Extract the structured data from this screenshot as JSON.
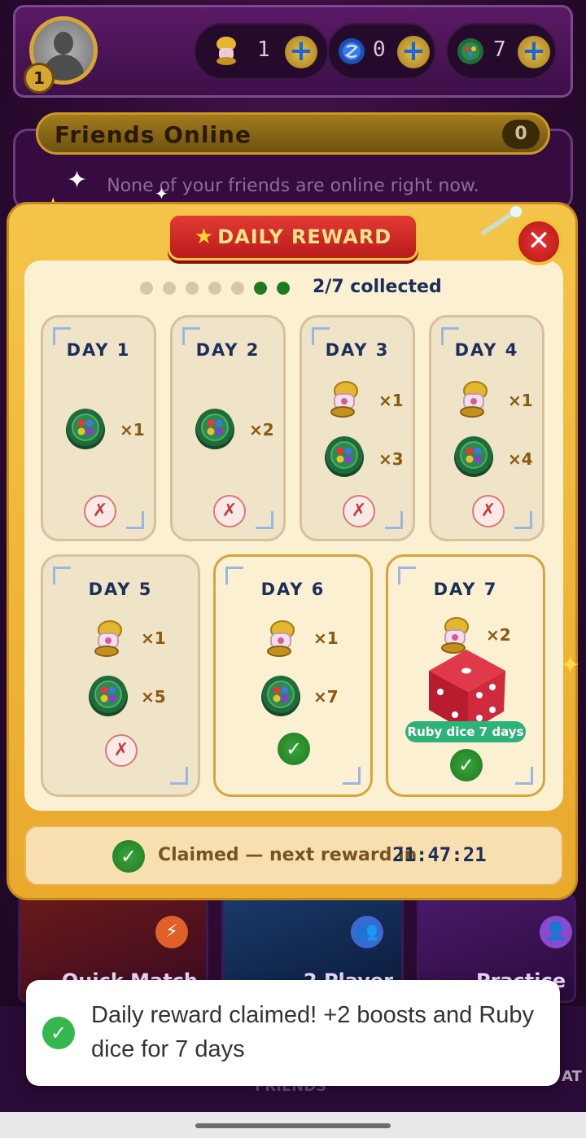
{
  "topbar": {
    "level": "1",
    "currencies": [
      {
        "icon": "boost-icon",
        "value": "1"
      },
      {
        "icon": "token-icon",
        "value": "0"
      },
      {
        "icon": "coin-icon",
        "value": "7"
      }
    ],
    "plus_label": "+"
  },
  "friends": {
    "title": "Friends Online",
    "count": "0",
    "empty_text": "None of your friends are online right now."
  },
  "modal": {
    "title": "DAILY REWARD",
    "title_star": "★",
    "close_label": "✕",
    "progress": {
      "collected_text": "2/7 collected",
      "total": 7,
      "collected": 2
    },
    "days": [
      {
        "title": "DAY 1",
        "boost_qty": "",
        "coin_qty": "×1",
        "status": "missed"
      },
      {
        "title": "DAY 2",
        "boost_qty": "",
        "coin_qty": "×2",
        "status": "missed"
      },
      {
        "title": "DAY 3",
        "boost_qty": "×1",
        "coin_qty": "×3",
        "status": "missed"
      },
      {
        "title": "DAY 4",
        "boost_qty": "×1",
        "coin_qty": "×4",
        "status": "missed"
      },
      {
        "title": "DAY 5",
        "boost_qty": "×1",
        "coin_qty": "×5",
        "status": "missed"
      },
      {
        "title": "DAY 6",
        "boost_qty": "×1",
        "coin_qty": "×7",
        "status": "claimed"
      },
      {
        "title": "DAY 7",
        "boost_qty": "×2",
        "badge": "Ruby dice 7 days",
        "status": "claimed"
      }
    ],
    "missed_mark": "✗",
    "claimed_mark": "✓",
    "footer": {
      "text": "Claimed — next reward in",
      "timer": "21:47:21",
      "mark": "✓"
    }
  },
  "game_modes": [
    {
      "label": "Quick Match"
    },
    {
      "label": "2 Player"
    },
    {
      "label": "Practice"
    }
  ],
  "nav": {
    "friends": "FRIENDS",
    "chat": "AT"
  },
  "toast": {
    "text": "Daily reward claimed! +2 boosts and Ruby dice for 7 days",
    "mark": "✓"
  },
  "colors": {
    "modal_bg": "#f4c54a",
    "banner_red": "#d12a2a",
    "title_navy": "#1c2f5a",
    "claimed_green": "#2f8f2f",
    "missed_red": "#c43a3a",
    "badge_green": "#2fb27a",
    "dot_filled": "#1f7a1f",
    "dot_empty": "#d6c8a4"
  }
}
